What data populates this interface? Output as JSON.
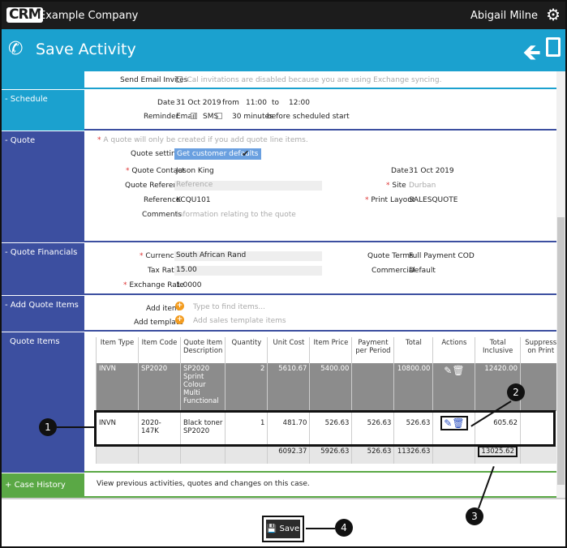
{
  "app": {
    "logo": "CRM",
    "company": "Example Company",
    "user": "Abigail Milne",
    "icons": [
      "gear-icon",
      "phone-icon",
      "back-arrow-icon",
      "save-icon"
    ]
  },
  "header": {
    "title": "Save Activity"
  },
  "email": {
    "label": "Send Email Invites",
    "note": "iCal invitations are disabled because you are using Exchange syncing."
  },
  "schedule": {
    "section": "Schedule",
    "date_label": "Date",
    "date": "31 Oct 2019",
    "from": "from",
    "start": "11:00",
    "to": "to",
    "end": "12:00",
    "reminder_label": "Reminder",
    "email": "Email",
    "sms": "SMS",
    "minutes": "30 minutes",
    "before": "before scheduled start"
  },
  "quote": {
    "section": "Quote",
    "note": "A quote will only be created if you add quote line items.",
    "settings_label": "Quote settings",
    "defaults_button": "Get customer defaults",
    "contact_label": "Quote Contact",
    "contact": "Jason King",
    "ref_label": "Quote Reference",
    "ref_placeholder": "Reference",
    "reference_label": "Reference",
    "reference": "KCQU101",
    "comments_label": "Comments",
    "comments_placeholder": "Information relating to the quote",
    "date_label": "Date",
    "date": "31 Oct 2019",
    "site_label": "Site",
    "site": "Durban",
    "layout_label": "Print Layout",
    "layout": "SALESQUOTE"
  },
  "financials": {
    "section": "Quote Financials",
    "currency_label": "Currency",
    "currency": "South African Rand",
    "tax_label": "Tax Rate",
    "tax": "15.00",
    "exchange_label": "Exchange Rate",
    "exchange": "1.0000",
    "terms_label": "Quote Terms",
    "terms": "Full Payment COD",
    "commercial_label": "Commercial",
    "commercial": "Default"
  },
  "add_items": {
    "section": "Add Quote Items",
    "item_label": "Add item",
    "item_placeholder": "Type to find items...",
    "template_label": "Add template",
    "template_placeholder": "Add sales template items"
  },
  "items": {
    "section": "Quote Items",
    "columns": [
      "Item Type",
      "Item Code",
      "Quote Item Description",
      "Quantity",
      "Unit Cost",
      "Item Price",
      "Payment per Period",
      "Total",
      "Actions",
      "Total Inclusive",
      "Suppress on Print"
    ],
    "rows": [
      [
        "INVN",
        "SP2020",
        "SP2020 Sprint Colour Multi Functional",
        "2",
        "5610.67",
        "5400.00",
        "",
        "10800.00",
        "",
        "12420.00",
        ""
      ],
      [
        "INVN",
        "2020-147K",
        "Black toner SP2020",
        "1",
        "481.70",
        "526.63",
        "526.63",
        "526.63",
        "",
        "605.62",
        ""
      ]
    ],
    "totals": [
      "",
      "",
      "",
      "",
      "6092.37",
      "5926.63",
      "526.63",
      "11326.63",
      "",
      "13025.62",
      ""
    ]
  },
  "history": {
    "section": "Case History",
    "text": "View previous activities, quotes and changes on this case."
  },
  "footer": {
    "save": "Save"
  },
  "callouts": [
    "1",
    "2",
    "3",
    "4"
  ],
  "colors": {
    "topbar": "#1c1c1c",
    "header": "#1ba1cf",
    "section_blue": "#3c4fa0",
    "history_green": "#5aa845",
    "accent_orange": "#f39c1f"
  }
}
